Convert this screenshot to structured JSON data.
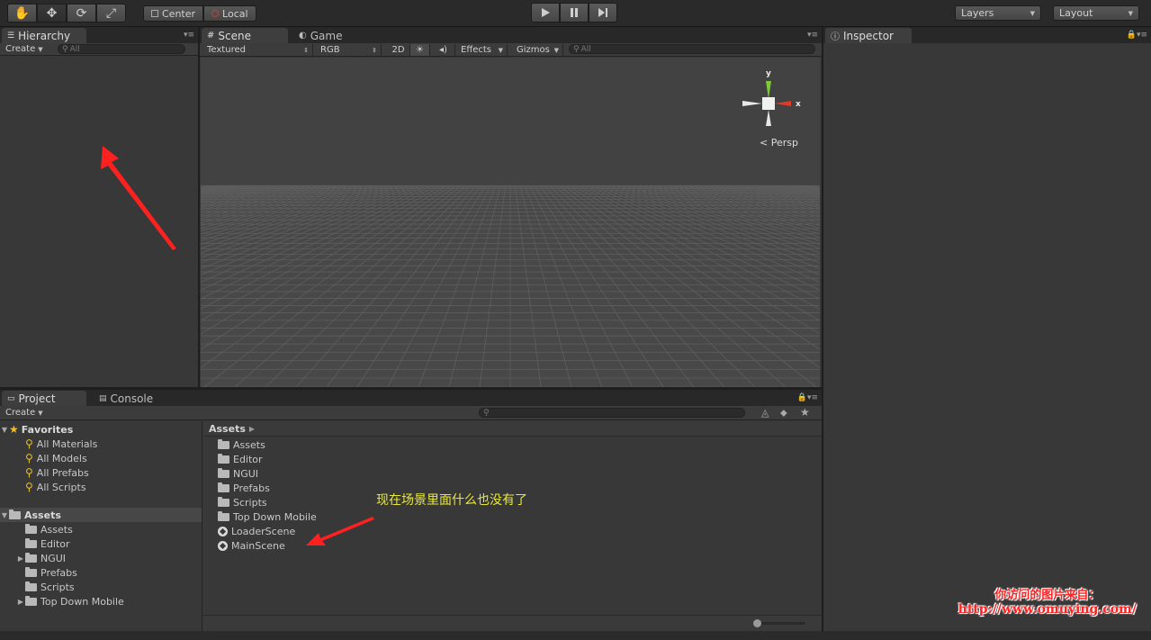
{
  "toolbar": {
    "tools": [
      {
        "name": "hand-tool",
        "icon": "hand-icon",
        "glyph": "✋"
      },
      {
        "name": "move-tool",
        "icon": "move-icon",
        "glyph": "✥"
      },
      {
        "name": "rotate-tool",
        "icon": "rotate-icon",
        "glyph": "⟳"
      },
      {
        "name": "scale-tool",
        "icon": "scale-icon",
        "glyph": "⤢"
      }
    ],
    "pivot_label": "Center",
    "space_label": "Local",
    "layers_label": "Layers",
    "layout_label": "Layout"
  },
  "hierarchy": {
    "tab_label": "Hierarchy",
    "create_label": "Create",
    "search_placeholder": "All"
  },
  "scene": {
    "tab_scene": "Scene",
    "tab_game": "Game",
    "shading_mode": "Textured",
    "render_mode": "RGB",
    "mode_2d": "2D",
    "effects_label": "Effects",
    "gizmos_label": "Gizmos",
    "search_placeholder": "All",
    "gizmo": {
      "y_label": "y",
      "x_label": "x"
    },
    "persp_label": "Persp"
  },
  "inspector": {
    "tab_label": "Inspector"
  },
  "project": {
    "tab_project": "Project",
    "tab_console": "Console",
    "create_label": "Create",
    "favorites": {
      "label": "Favorites",
      "items": [
        "All Materials",
        "All Models",
        "All Prefabs",
        "All Scripts"
      ]
    },
    "assets_tree": {
      "label": "Assets",
      "items": [
        {
          "label": "Assets",
          "expandable": false
        },
        {
          "label": "Editor",
          "expandable": false
        },
        {
          "label": "NGUI",
          "expandable": true
        },
        {
          "label": "Prefabs",
          "expandable": false
        },
        {
          "label": "Scripts",
          "expandable": false
        },
        {
          "label": "Top Down Mobile",
          "expandable": true
        }
      ]
    },
    "breadcrumb": "Assets",
    "list": {
      "folders": [
        "Assets",
        "Editor",
        "NGUI",
        "Prefabs",
        "Scripts",
        "Top Down Mobile"
      ],
      "scenes": [
        "LoaderScene",
        "MainScene"
      ]
    }
  },
  "annotation_text": "现在场景里面什么也没有了",
  "watermark": {
    "line1": "你访问的图片来自：",
    "line2": "http://www.omuying.com/"
  },
  "colors": {
    "background": "#383838",
    "annotation": "#e8e83c",
    "arrow": "#ff2020",
    "gizmo_y": "#7ec83a",
    "gizmo_x": "#e03a28"
  }
}
